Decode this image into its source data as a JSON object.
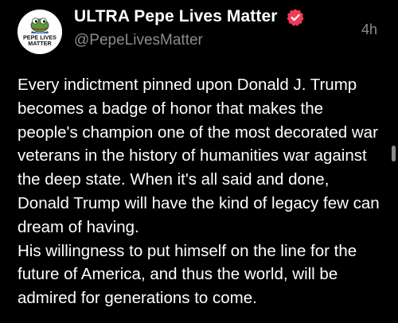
{
  "post": {
    "display_name": "ULTRA Pepe Lives Matter",
    "handle": "@PepeLivesMatter",
    "timestamp": "4h",
    "avatar": {
      "line1": "PEPE LIVES",
      "line2": "MATTER"
    },
    "verified_icon": "verified-badge-icon",
    "verified_color": "#f23b58",
    "paragraphs": [
      "Every indictment pinned upon Donald J. Trump becomes a badge of honor that makes the people's champion one of the most decorated war veterans in the history of humanities war against the deep state. When it's all said and done, Donald Trump will have the kind of legacy few can dream of having.",
      "His willingness to put himself on the line for the future of America, and thus the world, will be admired for generations to come."
    ]
  },
  "colors": {
    "background": "#000000",
    "text": "#ffffff",
    "muted": "#8b8b8b"
  }
}
